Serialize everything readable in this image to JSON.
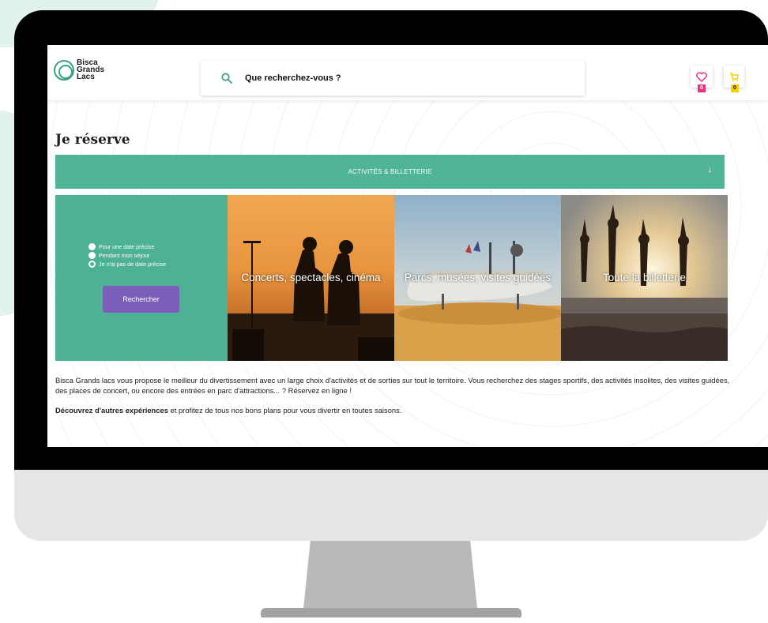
{
  "site": {
    "logo_lines": [
      "Bisca",
      "Grands",
      "Lacs"
    ]
  },
  "header": {
    "search_placeholder": "Que recherchez-vous ?",
    "favorites_count": "0",
    "cart_count": "0"
  },
  "main": {
    "title": "Je réserve",
    "accordion_label": "ACTIVITÉS & BILLETTERIE",
    "accordion_arrow": "↓",
    "filter": {
      "options": [
        "Pour une date précise",
        "Pendant mon séjour",
        "Je n'ai pas de date précise"
      ],
      "selected_index": 2,
      "button_label": "Rechercher"
    },
    "cards": [
      {
        "title": "Concerts, spectacles, cinéma"
      },
      {
        "title": "Parcs, musées, visites guidées"
      },
      {
        "title": "Toute la billetterie"
      }
    ],
    "intro_text": "Bisca Grands lacs vous propose le meilleur du divertissement avec un large choix d'activités et de sorties sur tout le territoire. Vous recherchez des stages sportifs, des activités insolites, des visites guidées, des places de concert, ou encore des entrées en parc d'attractions... ? Réservez en ligne !",
    "promo_bold": "Découvrez d'autres expériences",
    "promo_rest": " et profitez  de tous nos bons plans pour vous divertir en toutes saisons."
  },
  "colors": {
    "brand_green": "#50b596",
    "button_purple": "#7b5eb9",
    "badge_pink": "#e5337d",
    "badge_yellow": "#f4d000"
  }
}
